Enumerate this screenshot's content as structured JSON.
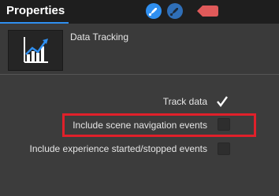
{
  "header": {
    "tab_label": "Properties",
    "icons": [
      "rocket-settings-icon",
      "rocket-dark-icon",
      "tag-icon"
    ]
  },
  "widget": {
    "title": "Data Tracking",
    "icon": "line-chart-icon"
  },
  "options": [
    {
      "label": "Track data",
      "checked": true
    },
    {
      "label": "Include scene navigation events",
      "checked": false
    },
    {
      "label": "Include experience started/stopped events",
      "checked": false
    }
  ],
  "colors": {
    "accent": "#2f8ff0",
    "highlight": "#e0202a",
    "tag": "#e05a5a"
  }
}
